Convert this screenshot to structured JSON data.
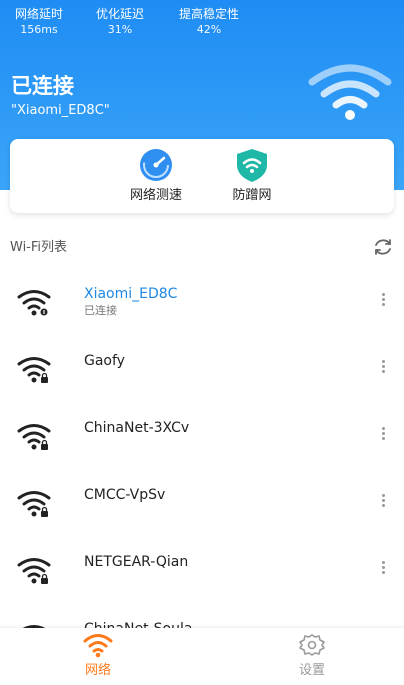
{
  "header": {
    "stats": [
      {
        "label": "网络延时",
        "value": "156ms"
      },
      {
        "label": "优化延迟",
        "value": "31%"
      },
      {
        "label": "提高稳定性",
        "value": "42%"
      }
    ],
    "status_title": "已连接",
    "ssid": "\"Xiaomi_ED8C\"",
    "wifi_icon": "wifi-signal-large-icon",
    "gradient_top": "#1e8cf4",
    "gradient_bottom": "#3aa5f8"
  },
  "tools": [
    {
      "label": "网络测速",
      "icon": "speedometer-icon"
    },
    {
      "label": "防蹭网",
      "icon": "shield-wifi-icon"
    }
  ],
  "list": {
    "title": "Wi-Fi列表",
    "refresh_icon": "refresh-icon",
    "items": [
      {
        "name": "Xiaomi_ED8C",
        "status": "已连接",
        "connected": true,
        "locked": false
      },
      {
        "name": "Gaofy",
        "status": "",
        "connected": false,
        "locked": true
      },
      {
        "name": "ChinaNet-3XCv",
        "status": "",
        "connected": false,
        "locked": true
      },
      {
        "name": "CMCC-VpSv",
        "status": "",
        "connected": false,
        "locked": true
      },
      {
        "name": "NETGEAR-Qian",
        "status": "",
        "connected": false,
        "locked": true
      },
      {
        "name": "ChinaNet-Soula",
        "status": "",
        "connected": false,
        "locked": true
      }
    ]
  },
  "bottom_nav": {
    "tabs": [
      {
        "label": "网络",
        "icon": "wifi-tab-icon",
        "active": true
      },
      {
        "label": "设置",
        "icon": "gear-icon",
        "active": false
      }
    ],
    "active_color": "#ff7a1a",
    "inactive_color": "#9a9a9a"
  },
  "colors": {
    "connected_name": "#1e88e5"
  }
}
